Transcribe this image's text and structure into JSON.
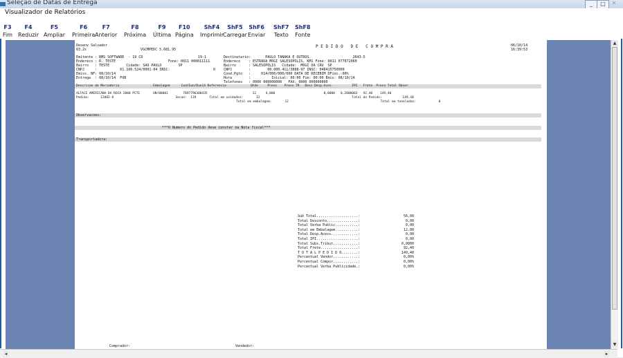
{
  "window": {
    "title": "Seleção de Datas de Entrega",
    "inner_title": "Visualizador de Relatórios"
  },
  "toolbar": [
    {
      "key": "F3",
      "label": "Fim"
    },
    {
      "key": "F4",
      "label": "Reduzir"
    },
    {
      "key": "F5",
      "label": "Ampliar"
    },
    {
      "key": "F6",
      "label": "Primeira"
    },
    {
      "key": "F7",
      "label": "Anterior"
    },
    {
      "key": "F8",
      "label": "Próxima"
    },
    {
      "key": "F9",
      "label": "Última"
    },
    {
      "key": "F10",
      "label": "Página"
    },
    {
      "key": "ShF4",
      "label": "Imprimir"
    },
    {
      "key": "ShF5",
      "label": "Carregar"
    },
    {
      "key": "ShF6",
      "label": "Enviar"
    },
    {
      "key": "ShF7",
      "label": "Texto"
    },
    {
      "key": "ShF8",
      "label": "Fonte"
    }
  ],
  "report": {
    "header": {
      "user": "Desenv Salvador",
      "version_left": "03.2s",
      "program": "VGCMPEDC 5.681.95",
      "title": "P E D I D O   D E   C O M P R A",
      "date": "06/10/14",
      "time": "16:39:53"
    },
    "left_info": [
      "Emitente : RMS SOFTWARE  - 19 CD",
      "Endereco : R. TESTE",
      "Bairro   : TESTE        Cidade: SAO PAULO        SP",
      "CNPJ     :           61.106.524/0001-04 INSC:",
      "Emiss. NF: 08/10/14",
      "Entrega  : 08/10/14  FOB"
    ],
    "mid_info": [
      "19-1",
      "Fone: 0011 000011111",
      "",
      "0"
    ],
    "right_info": [
      "Destinatario:       PAULO TANAKA E OUTROS.                    2643-5",
      "Endereco    : ESTRADA MOGI SALESOPOLIS, KM1 Fone: 0011 077872060",
      "Bairro      : SALESOPOLIS   Cidade:  MOGI DA CRU  SP",
      "CNPJ        :        00.000.411/3888-97 INSC: 048415750000",
      "Cond.Pgto   :     014/000/000/000 DATA DE RECEBIM DFinc.:00%",
      "Hora        :          Inicial: 00:00 Fim: 00:00 Emis: 08/10/14",
      "Telefones   : 0000 000000000   FAX: 0000 000000000"
    ],
    "items_header": "Descricao da Mercadoria                  Embalagem      Cod/Ean/Dun14 Referencia             Qtde     Preco    Preco TR   Desc Desp.Aces.          IPI   Frete  Preco Total Obser",
    "item_line": "ALFACE AMERICANA DA ROCA 2000 PCTE       UN/00001        7897796300435                        12     4,800                          0,0000   0,2800003   92,40    149,40",
    "pedido_line": "Pedido:      12082-8                                 Secao:  119       Total em unidades:       12                                                 Total do Pedido:           149,40",
    "embalagem_line": "Total em embalagem:       12                                                 Total em toneladas:            0",
    "observacoes_label": "Observacoes:",
    "nota_fiscal_msg": "***O Numero do Pedido deve constar na Nota fiscal***",
    "transportadora_label": "Transportadora:",
    "totals": [
      {
        "label": "Sub Total....................:",
        "value": "56,00"
      },
      {
        "label": "Total Desconto...............:",
        "value": "0,00"
      },
      {
        "label": "Total Verba Public...........:",
        "value": "0,00"
      },
      {
        "label": "Total em Embalagem...........:",
        "value": "12,00"
      },
      {
        "label": "Total Desp.Acess.............:",
        "value": "0,00"
      },
      {
        "label": "Total IPI....................:",
        "value": "0,00"
      },
      {
        "label": "Total Subs.Tribut............:",
        "value": "0,0000"
      },
      {
        "label": "Total Frete..................:",
        "value": "92,40"
      },
      {
        "label": "T O T A L P E D I D O........:",
        "value": "149,40"
      },
      {
        "label": "Percentual Vendor............:",
        "value": "0,00%"
      },
      {
        "label": "Percentual Compor............:",
        "value": "0,00%"
      },
      {
        "label": "Percentual Verba Publicidade.:",
        "value": "0,00%"
      }
    ],
    "footer": {
      "comprador": "Comprador:",
      "vendedor": "Vendedor:"
    }
  }
}
